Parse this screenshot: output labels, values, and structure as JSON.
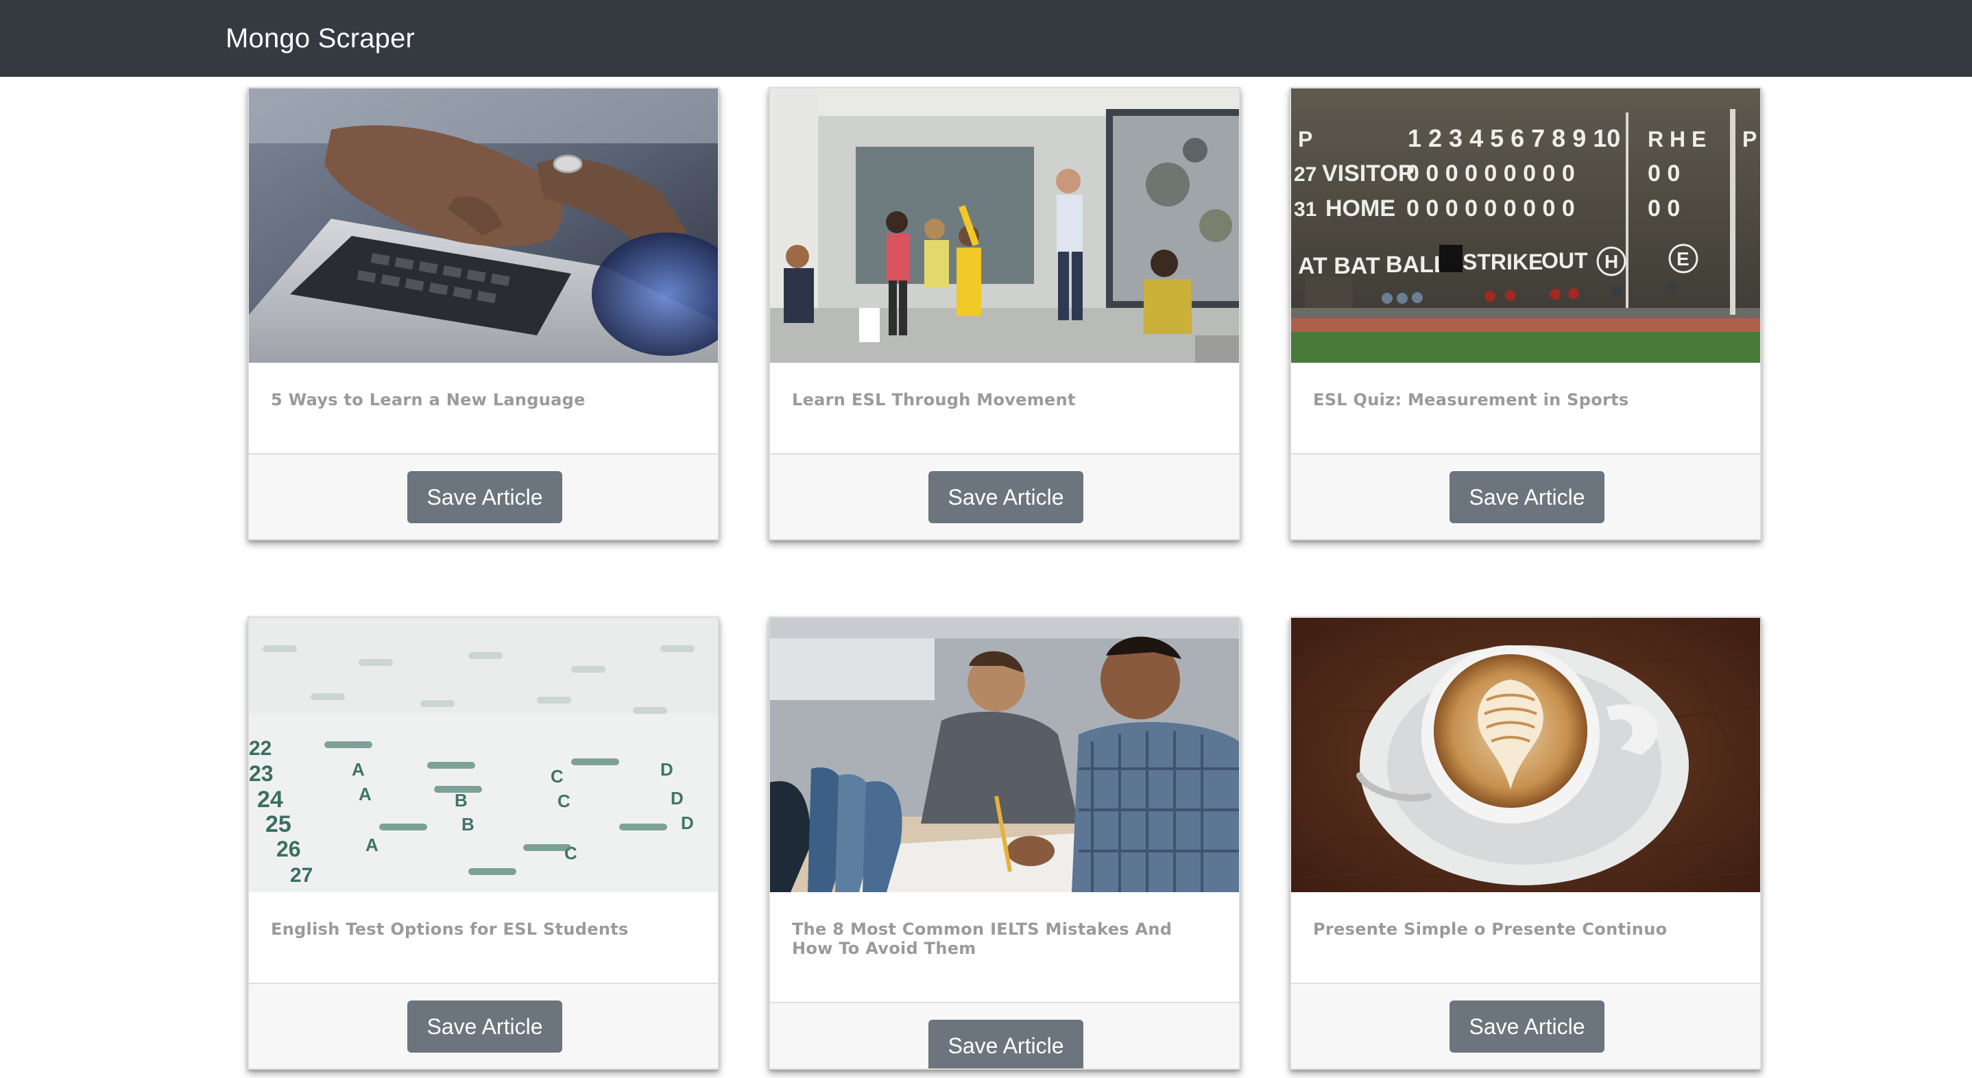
{
  "navbar": {
    "brand": "Mongo Scraper"
  },
  "articles": [
    {
      "title": "5 Ways to Learn a New Language",
      "button_label": "Save Article"
    },
    {
      "title": "Learn ESL Through Movement",
      "button_label": "Save Article"
    },
    {
      "title": "ESL Quiz: Measurement in Sports",
      "button_label": "Save Article"
    },
    {
      "title": "English Test Options for ESL Students",
      "button_label": "Save Article"
    },
    {
      "title": "The 8 Most Common IELTS Mistakes And How To Avoid Them",
      "button_label": "Save Article"
    },
    {
      "title": "Presente Simple o Presente Continuo",
      "button_label": "Save Article"
    }
  ],
  "scoreboard": {
    "header_p": "P",
    "innings": "1 2 3 4 5 6 7 8 9 10",
    "rhe": "R  H  E",
    "header_p2": "P",
    "visitor_num": "27",
    "visitor_label": "VISITOR",
    "visitor_scores": "0 0 0  0 0 0  0 0 0",
    "visitor_rhe": "0  0",
    "home_num": "31",
    "home_label": "HOME",
    "home_scores": "0 0 0  0 0 0  0 0 0",
    "home_rhe": "0  0",
    "at_bat": "AT BAT",
    "ball": "BALL",
    "strike": "STRIKE",
    "out": "OUT",
    "h_mark": "H",
    "e_mark": "E"
  },
  "answer_sheet": {
    "numbers": [
      "22",
      "23",
      "24",
      "25",
      "26",
      "27"
    ],
    "letters": [
      "A",
      "B",
      "C",
      "D"
    ]
  },
  "colors": {
    "navbar_bg": "#343a40",
    "button_bg": "#6c757d",
    "title_text": "#9a9a9a"
  }
}
